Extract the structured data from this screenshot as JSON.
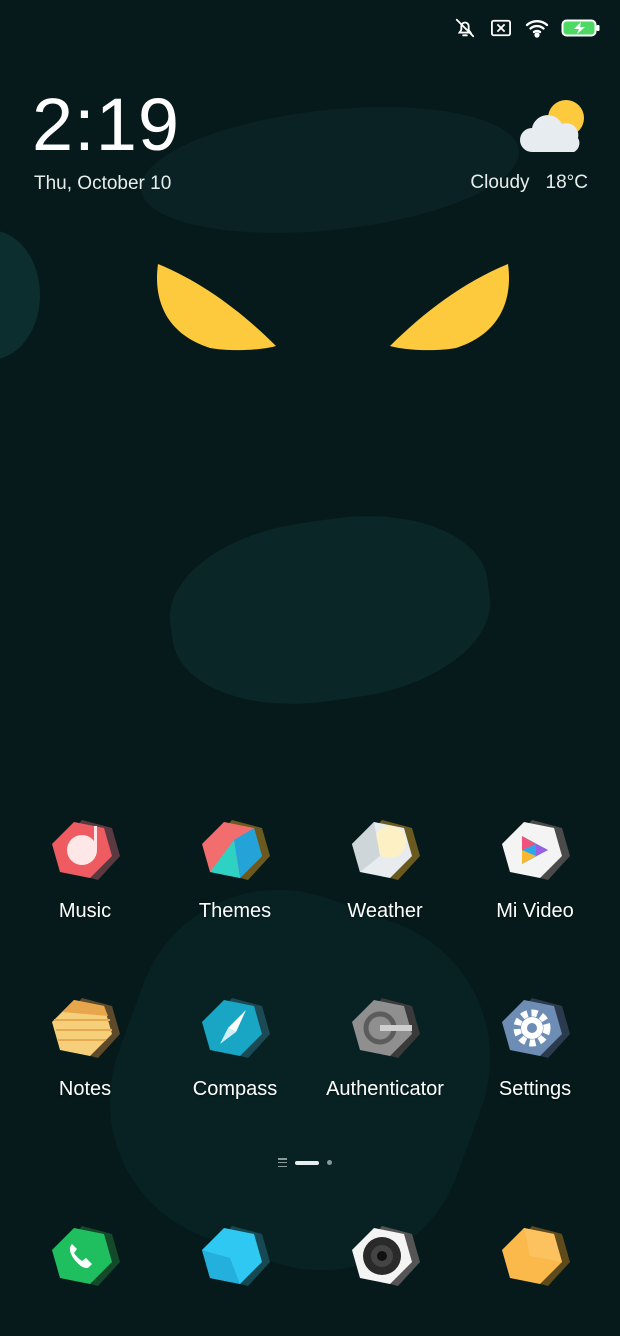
{
  "status_bar": {
    "icons": [
      "bell-off-icon",
      "no-sim-icon",
      "wifi-icon",
      "battery-charging-icon"
    ],
    "battery_color": "#4cd964"
  },
  "clock": {
    "time": "2:19",
    "date": "Thu, October 10"
  },
  "weather_widget": {
    "icon": "partly-cloudy-icon",
    "condition": "Cloudy",
    "temperature": "18°C"
  },
  "apps": [
    [
      {
        "label": "Music",
        "icon": "music-icon"
      },
      {
        "label": "Themes",
        "icon": "themes-icon"
      },
      {
        "label": "Weather",
        "icon": "weather-icon"
      },
      {
        "label": "Mi Video",
        "icon": "mi-video-icon"
      }
    ],
    [
      {
        "label": "Notes",
        "icon": "notes-icon"
      },
      {
        "label": "Compass",
        "icon": "compass-icon"
      },
      {
        "label": "Authenticator",
        "icon": "authenticator-icon"
      },
      {
        "label": "Settings",
        "icon": "settings-icon"
      }
    ]
  ],
  "page_indicator": {
    "pages": 2,
    "active_page": 1
  },
  "dock": [
    {
      "icon": "phone-icon"
    },
    {
      "icon": "messages-icon"
    },
    {
      "icon": "camera-icon"
    },
    {
      "icon": "browser-icon"
    }
  ]
}
